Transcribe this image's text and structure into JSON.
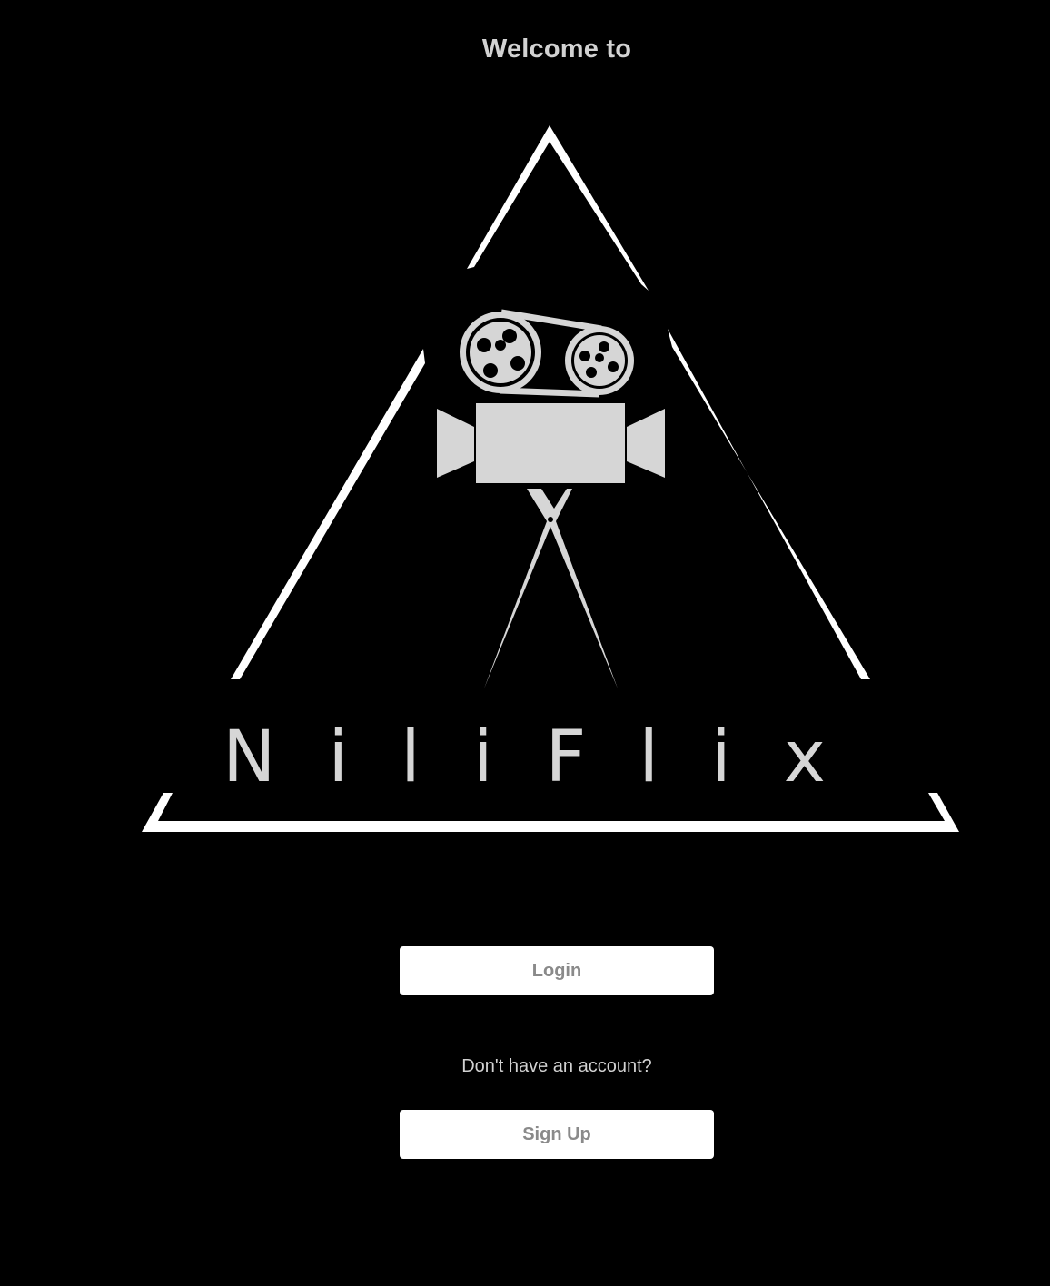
{
  "header": {
    "welcome_text": "Welcome to"
  },
  "logo": {
    "brand_name": "NiliFlix",
    "icon": "movie-camera-scissors-icon",
    "outline_color": "#ffffff",
    "mark_color": "#d6d6d6"
  },
  "actions": {
    "login_label": "Login",
    "no_account_text": "Don't have an account?",
    "signup_label": "Sign Up"
  },
  "colors": {
    "background": "#000000",
    "button_bg": "#ffffff",
    "button_text": "#8a8a8a",
    "text": "#d2d2d2"
  }
}
